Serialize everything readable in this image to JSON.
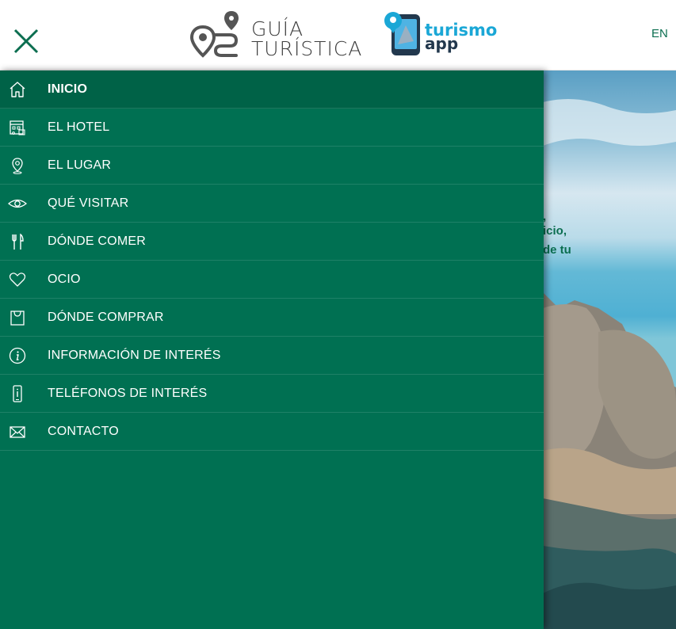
{
  "header": {
    "brand_line1": "GUÍA",
    "brand_line2": "TURÍSTICA",
    "app_line1": "turismo",
    "app_line2": "app",
    "lang_label": "EN"
  },
  "hero": {
    "line1": ",",
    "line2": "icio,",
    "line3": "de tu"
  },
  "menu": {
    "items": [
      {
        "label": "INICIO",
        "icon": "home-icon",
        "active": true
      },
      {
        "label": "EL HOTEL",
        "icon": "hotel-icon"
      },
      {
        "label": "EL LUGAR",
        "icon": "location-pin-icon"
      },
      {
        "label": "QUÉ VISITAR",
        "icon": "eye-icon"
      },
      {
        "label": "DÓNDE COMER",
        "icon": "fork-knife-icon"
      },
      {
        "label": "OCIO",
        "icon": "heart-icon"
      },
      {
        "label": "DÓNDE COMPRAR",
        "icon": "shopping-bag-icon"
      },
      {
        "label": "INFORMACIÓN DE INTERÉS",
        "icon": "info-icon"
      },
      {
        "label": "TELÉFONOS DE INTERÉS",
        "icon": "phone-icon"
      },
      {
        "label": "CONTACTO",
        "icon": "envelope-icon"
      }
    ]
  },
  "colors": {
    "drawer_bg": "#007052",
    "active_bg": "#006247",
    "accent": "#0b6e50",
    "app_blue": "#1aa7d6"
  }
}
